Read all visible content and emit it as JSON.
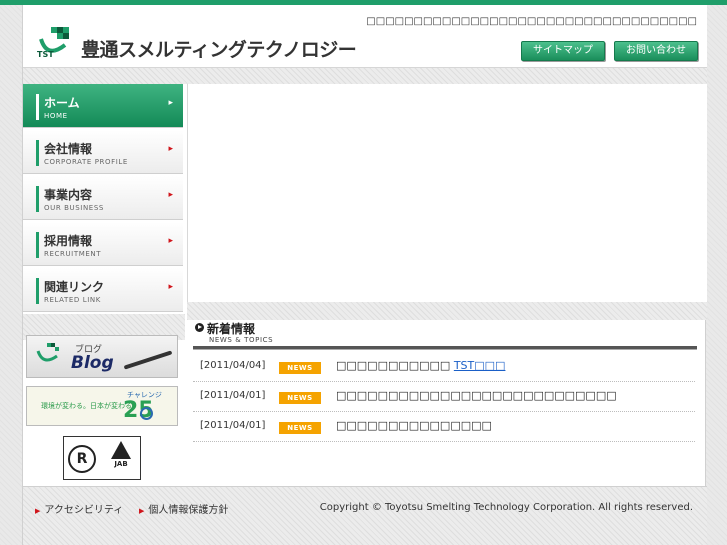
{
  "header": {
    "company_name": "豊通スメルティングテクノロジー",
    "logo_abbr": "TST",
    "tagline": "□□□□□□□□□□□□□□□□□□□□□□□□□□□□□□□□□□□",
    "buttons": {
      "sitemap": "サイトマップ",
      "contact": "お問い合わせ"
    }
  },
  "nav": {
    "items": [
      {
        "jp": "ホーム",
        "en": "HOME",
        "active": true
      },
      {
        "jp": "会社情報",
        "en": "CORPORATE PROFILE"
      },
      {
        "jp": "事業内容",
        "en": "OUR BUSINESS"
      },
      {
        "jp": "採用情報",
        "en": "RECRUITMENT"
      },
      {
        "jp": "関連リンク",
        "en": "RELATED LINK"
      }
    ]
  },
  "banners": {
    "blog": {
      "jp": "ブログ",
      "en": "Blog"
    },
    "challenge": {
      "slogan": "環境が変わる。日本が変わる。",
      "label": "チャレンジ",
      "number": "25"
    },
    "cert": {
      "r": "R",
      "jab": "JAB"
    }
  },
  "news": {
    "heading_jp": "新着情報",
    "heading_en": "NEWS & TOPICS",
    "badge": "NEWS",
    "items": [
      {
        "date": "[2011/04/04]",
        "title": "□□□□□□□□□□□",
        "link": "TST□□□"
      },
      {
        "date": "[2011/04/01]",
        "title": "□□□□□□□□□□□□□□□□□□□□□□□□□□□",
        "link": ""
      },
      {
        "date": "[2011/04/01]",
        "title": "□□□□□□□□□□□□□□□",
        "link": ""
      }
    ]
  },
  "footer": {
    "accessibility": "アクセシビリティ",
    "privacy": "個人情報保護方針",
    "copyright": "Copyright © Toyotsu Smelting Technology Corporation. All rights reserved."
  },
  "colors": {
    "brand_green": "#1f9e6a",
    "news_badge": "#f5a300",
    "arrow_red": "#d0151b"
  }
}
